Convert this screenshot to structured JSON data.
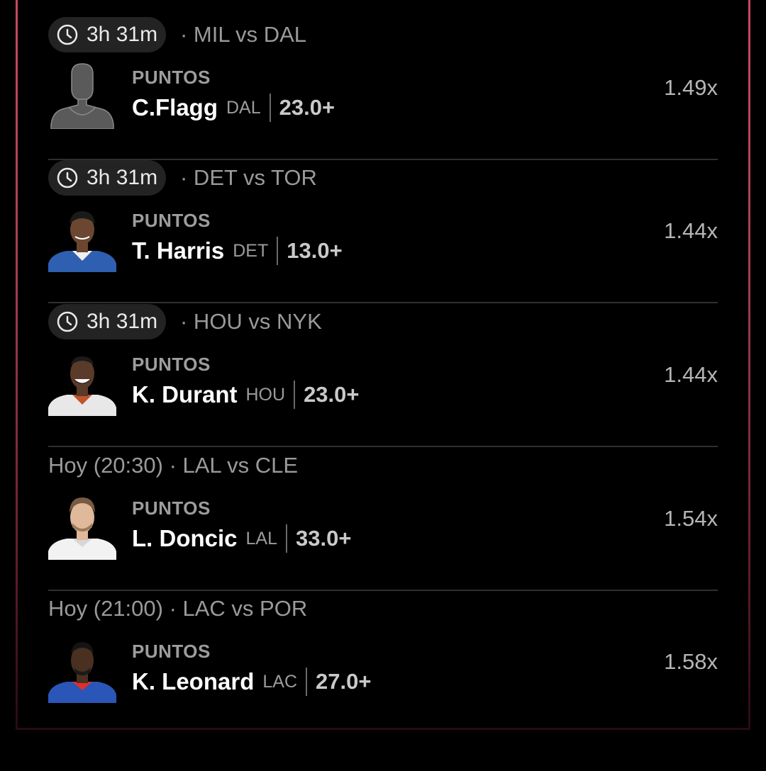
{
  "rows": [
    {
      "time": "3h 31m",
      "match": "· MIL vs DAL",
      "category": "PUNTOS",
      "player": "C.Flagg",
      "team": "DAL",
      "line": "23.0+",
      "multiplier": "1.49x",
      "avatar": "silhouette",
      "jersey": "#3a3a3a"
    },
    {
      "time": "3h 31m",
      "match": "· DET vs TOR",
      "category": "PUNTOS",
      "player": "T. Harris",
      "team": "DET",
      "line": "13.0+",
      "multiplier": "1.44x",
      "avatar": "photo",
      "jersey": "#2f5fb0",
      "skin": "#6b4630"
    },
    {
      "time": "3h 31m",
      "match": "· HOU vs NYK",
      "category": "PUNTOS",
      "player": "K. Durant",
      "team": "HOU",
      "line": "23.0+",
      "multiplier": "1.44x",
      "avatar": "photo",
      "jersey": "#e8e8e8",
      "skin": "#5a3a28"
    },
    {
      "header": "Hoy (20:30) · LAL vs CLE",
      "category": "PUNTOS",
      "player": "L. Doncic",
      "team": "LAL",
      "line": "33.0+",
      "multiplier": "1.54x",
      "avatar": "photo",
      "jersey": "#f2f2f2",
      "skin": "#e0b89a"
    },
    {
      "header": "Hoy (21:00) · LAC vs POR",
      "category": "PUNTOS",
      "player": "K. Leonard",
      "team": "LAC",
      "line": "27.0+",
      "multiplier": "1.58x",
      "avatar": "photo",
      "jersey": "#2a56b8",
      "skin": "#4a3020"
    }
  ]
}
